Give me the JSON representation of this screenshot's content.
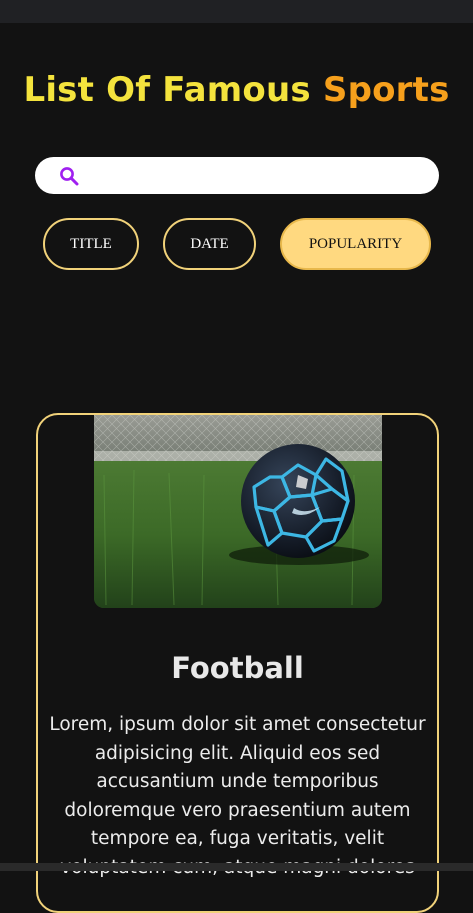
{
  "header": {
    "title_part_a": "List Of Famous",
    "title_part_b": "Sports"
  },
  "search": {
    "value": "",
    "icon": "search-icon",
    "icon_color": "#a020f0"
  },
  "sort_buttons": [
    {
      "label": "TITLE",
      "active": false
    },
    {
      "label": "DATE",
      "active": false
    },
    {
      "label": "POPULARITY",
      "active": true
    }
  ],
  "cards": [
    {
      "title": "Football",
      "image": "soccer-ball-on-grass",
      "description": "Lorem, ipsum dolor sit amet consectetur adipisicing elit. Aliquid eos sed accusantium unde temporibus doloremque vero praesentium autem tempore ea, fuga veritatis, velit voluptatem cum, atque magni dolores"
    }
  ],
  "colors": {
    "background": "#121212",
    "accent_yellow": "#f4e33d",
    "accent_orange": "#f6a01c",
    "border_gold": "#f1d27a",
    "active_fill": "#ffd980"
  }
}
